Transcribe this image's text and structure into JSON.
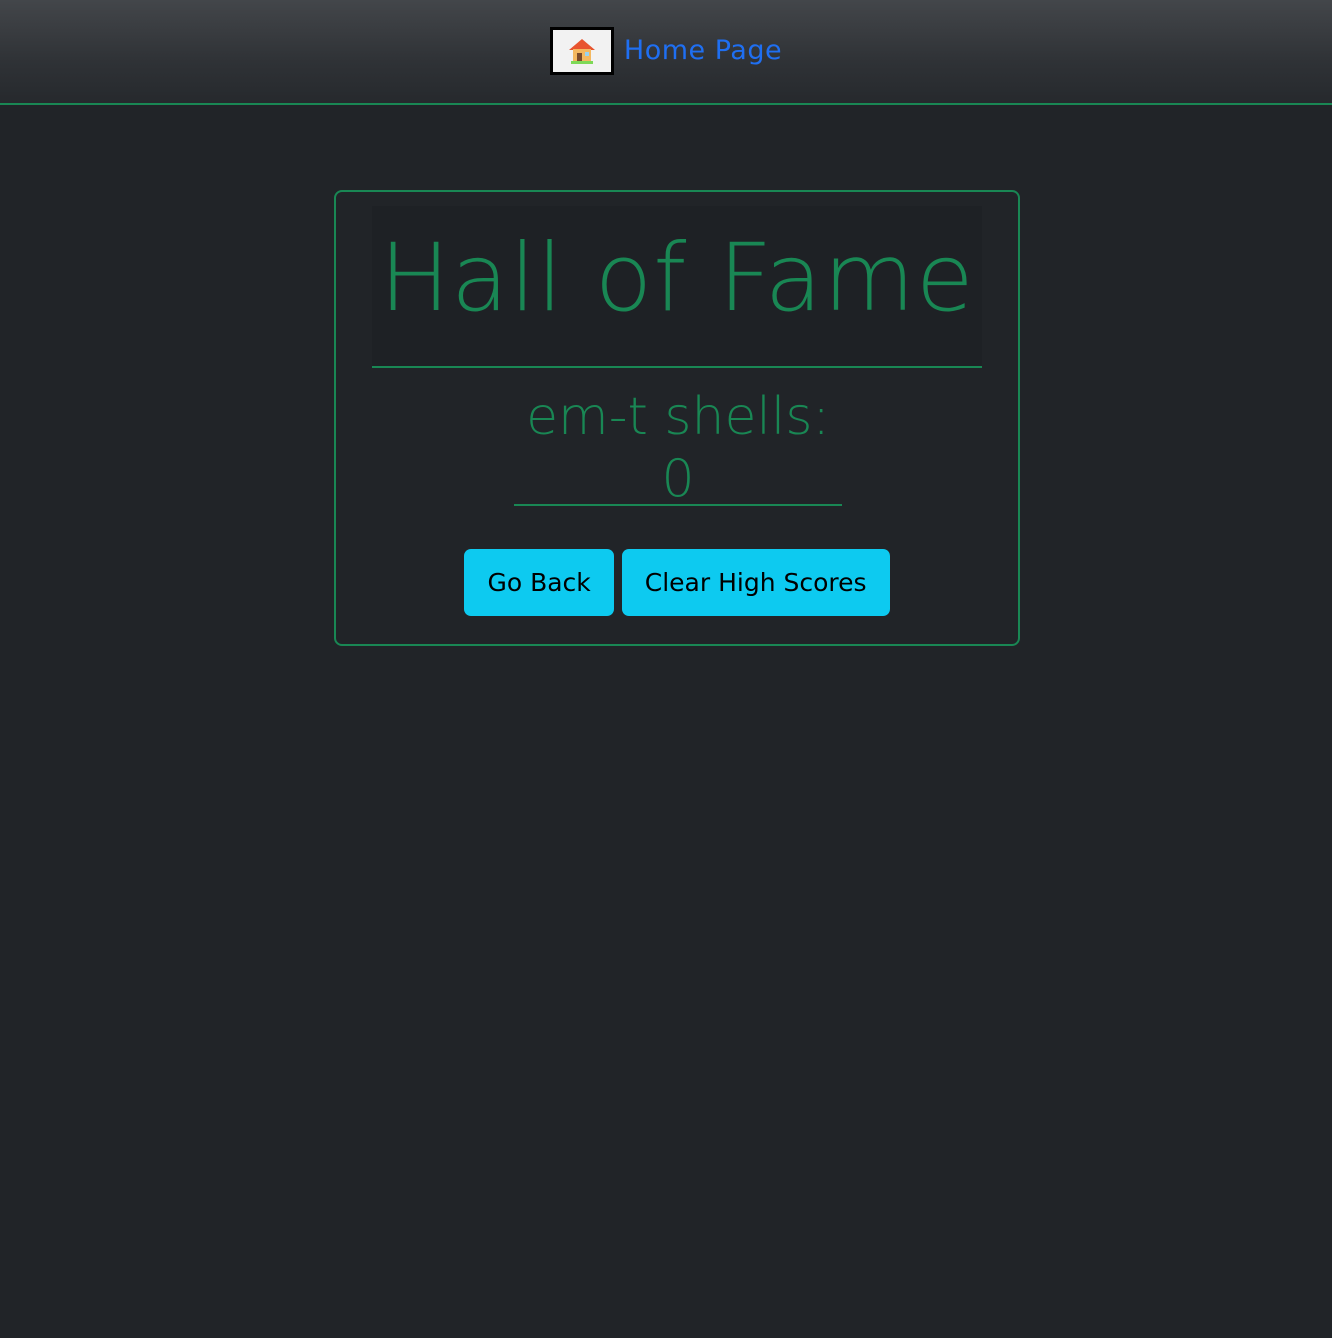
{
  "nav": {
    "home_icon": "house-icon",
    "home_label": "Home Page"
  },
  "card": {
    "title": "Hall of Fame",
    "scores": [
      "em-t shells: 0"
    ],
    "go_back_label": "Go Back",
    "clear_label": "Clear High Scores"
  },
  "colors": {
    "accent_green": "#198754",
    "button_cyan": "#0dcaf0",
    "link_blue": "#1f6ff2",
    "background": "#212428"
  }
}
